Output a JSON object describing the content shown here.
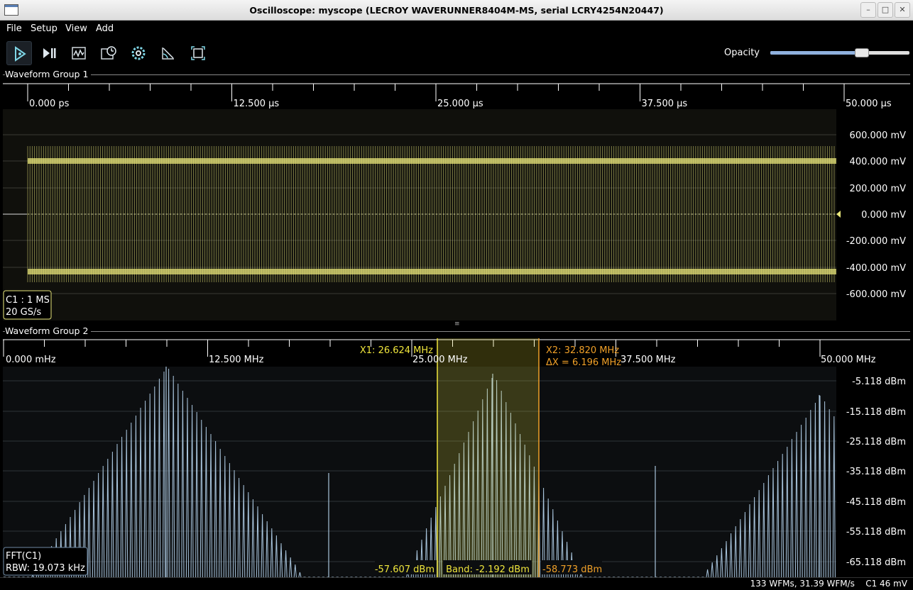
{
  "window": {
    "title": "Oscilloscope: myscope (LECROY WAVERUNNER8404M-MS, serial LCRY4254N20447)"
  },
  "menu": [
    "File",
    "Setup",
    "View",
    "Add"
  ],
  "toolbar": {
    "buttons": [
      "start-icon",
      "single-icon",
      "waveform-icon",
      "history-icon",
      "settings-icon",
      "measure-icon",
      "fullscreen-icon"
    ],
    "opacity_label": "Opacity",
    "opacity_value": 0.66
  },
  "group1": {
    "label": "Waveform Group 1",
    "time_ticks": [
      "0.000 ps",
      "12.500 µs",
      "25.000 µs",
      "37.500 µs",
      "50.000 µs"
    ],
    "voltage_ticks": [
      "600.000 mV",
      "400.000 mV",
      "200.000 mV",
      "0.000 mV",
      "-200.000 mV",
      "-400.000 mV",
      "-600.000 mV"
    ],
    "channel_line1": "C1 : 1 MS",
    "channel_line2": "20 GS/s",
    "trace_color": "#e8e67a"
  },
  "group2": {
    "label": "Waveform Group 2",
    "freq_ticks": [
      "0.000 mHz",
      "12.500 MHz",
      "25.000 MHz",
      "37.500 MHz",
      "50.000 MHz"
    ],
    "db_ticks": [
      "-5.118  dBm",
      "-15.118  dBm",
      "-25.118  dBm",
      "-35.118  dBm",
      "-45.118  dBm",
      "-55.118  dBm",
      "-65.118  dBm"
    ],
    "cursor_x1": "X1: 26.624 MHz",
    "cursor_x2": "X2: 32.820 MHz",
    "cursor_dx": "ΔX = 6.196 MHz",
    "band_left": "-57.607 dBm",
    "band_center": "Band: -2.192 dBm",
    "band_right": "-58.773 dBm",
    "channel_line1": "FFT(C1)",
    "channel_line2": "RBW: 19.073 kHz",
    "x1_color": "#f0e63c",
    "x2_color": "#f0a028",
    "trace_color": "#a8c4dc"
  },
  "status": {
    "text": "133 WFMs, 31.39 WFM/s    C1 46 mV"
  }
}
